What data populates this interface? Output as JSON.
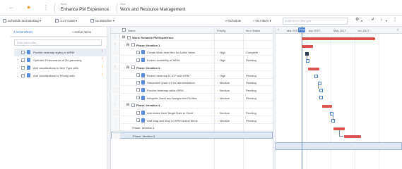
{
  "header": {
    "back_icon": "arrow-left-icon",
    "star_icon": "star-icon",
    "menu_icon": "more-vertical-icon",
    "work_label": "Work",
    "work_title": "Enhance PM Experience",
    "view_label": "View",
    "view_title": "Work and Resource Management"
  },
  "toolbar": {
    "schedule_backlog": "Schedule and Backlog",
    "gantt_cols": "1-17 Gantt",
    "baseline": "No Baseline",
    "schedule": "Schedule",
    "filters": "No Filters",
    "search_placeholder": "Enter text to filter grid",
    "icons": [
      "gear-icon",
      "wrench-icon",
      "download-icon",
      "more-vertical-icon"
    ]
  },
  "left_panel": {
    "tab_action_items": "Action Items",
    "tab_count": "4",
    "tab_active_items": "Active Items",
    "search_placeholder": "Enter text to filter",
    "items": [
      {
        "label": "Provide heatmap styling in WRM",
        "flag": "up",
        "flag_color": "#d9534f",
        "selected": true
      },
      {
        "label": "Optimize Performance of Re-parenting",
        "flag": "up",
        "flag_color": "#d9534f",
        "selected": false
      },
      {
        "label": "Add visualizations to Item Type cells",
        "flag": "mid",
        "flag_color": "#f0a030",
        "selected": false
      },
      {
        "label": "Add visualizations to Priority cells",
        "flag": "mid",
        "flag_color": "#f0a030",
        "selected": false
      }
    ]
  },
  "grid": {
    "columns": {
      "name": "Name",
      "priority": "Priority",
      "status": "Item Status"
    },
    "rows": [
      {
        "kind": "root",
        "name": "Work: Enhance PM Experience",
        "priority": "",
        "status": ""
      },
      {
        "kind": "phase",
        "name": "Phase: Iteration 1",
        "priority": "",
        "status": ""
      },
      {
        "kind": "task",
        "name": "Create Work Item tiles for Action Items",
        "priority": "High",
        "pcolor": "#d9534f",
        "status": "Complete"
      },
      {
        "kind": "task",
        "name": "Extend scalability of WRM",
        "priority": "High",
        "pcolor": "#d9534f",
        "status": "Pending"
      },
      {
        "kind": "phase",
        "name": "Phase: Iteration 2",
        "priority": "",
        "status": ""
      },
      {
        "kind": "task",
        "name": "Extend heatmap to ICP and WRM",
        "priority": "High",
        "pcolor": "#d9534f",
        "status": "Pending"
      },
      {
        "kind": "task",
        "name": "Streamline grant UX for administration",
        "priority": "Medium",
        "pcolor": "#f0a030",
        "status": "Pending"
      },
      {
        "kind": "task",
        "name": "Provide heatmap within RPM",
        "priority": "Medium",
        "pcolor": "#f0a030",
        "status": "Pending"
      },
      {
        "kind": "task",
        "name": "Integrate Gantt and Assignment Profiles",
        "priority": "Medium",
        "pcolor": "#f0a030",
        "status": "Pending"
      },
      {
        "kind": "phase",
        "name": "Phase: Iteration 3",
        "priority": "",
        "status": ""
      },
      {
        "kind": "task",
        "name": "Add Action Item Target Date to Gantt",
        "priority": "Medium",
        "pcolor": "#f0a030",
        "status": "Pending"
      },
      {
        "kind": "task",
        "name": "Add drag and drop to WRM Action Items",
        "priority": "Medium",
        "pcolor": "#f0a030",
        "status": "Pending"
      },
      {
        "kind": "phase_plain",
        "name": "Phase: Iteration 4",
        "priority": "",
        "status": ""
      },
      {
        "kind": "phase_plain_hl",
        "name": "Phase: Iteration 5",
        "priority": "",
        "status": ""
      }
    ]
  },
  "gantt": {
    "months": [
      "Mar 2017",
      "Apr 2017",
      "May 2017",
      "Jun 2017"
    ],
    "today_label": "Today",
    "bar_color": "#d9534f",
    "milestone_color": "#4a7fd0"
  }
}
